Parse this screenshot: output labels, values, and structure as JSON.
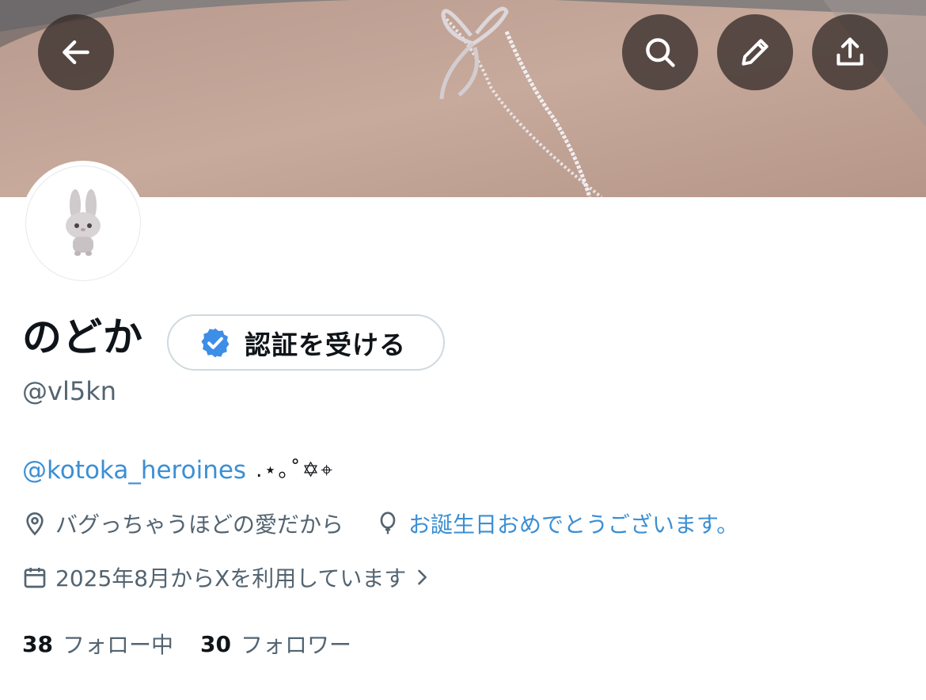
{
  "profile": {
    "display_name": "のどか",
    "handle": "@vl5kn",
    "verify_button_label": "認証を受ける",
    "bio_mention": "@kotoka_heroines",
    "bio_decoration": ".⋆｡˚✡︎⌖",
    "location": "バグっちゃうほどの愛だから",
    "birthday_link": "お誕生日おめでとうございます。",
    "joined": "2025年8月からXを利用しています"
  },
  "stats": {
    "following_count": "38",
    "following_label": "フォロー中",
    "followers_count": "30",
    "followers_label": "フォロワー"
  },
  "header_buttons": [
    "back-icon",
    "search-icon",
    "pencil-icon",
    "share-icon"
  ],
  "colors": {
    "link": "#3b8fd4",
    "badge": "#3d8ee6",
    "secondary_text": "#536471",
    "button_overlay": "#3a2f2c"
  }
}
